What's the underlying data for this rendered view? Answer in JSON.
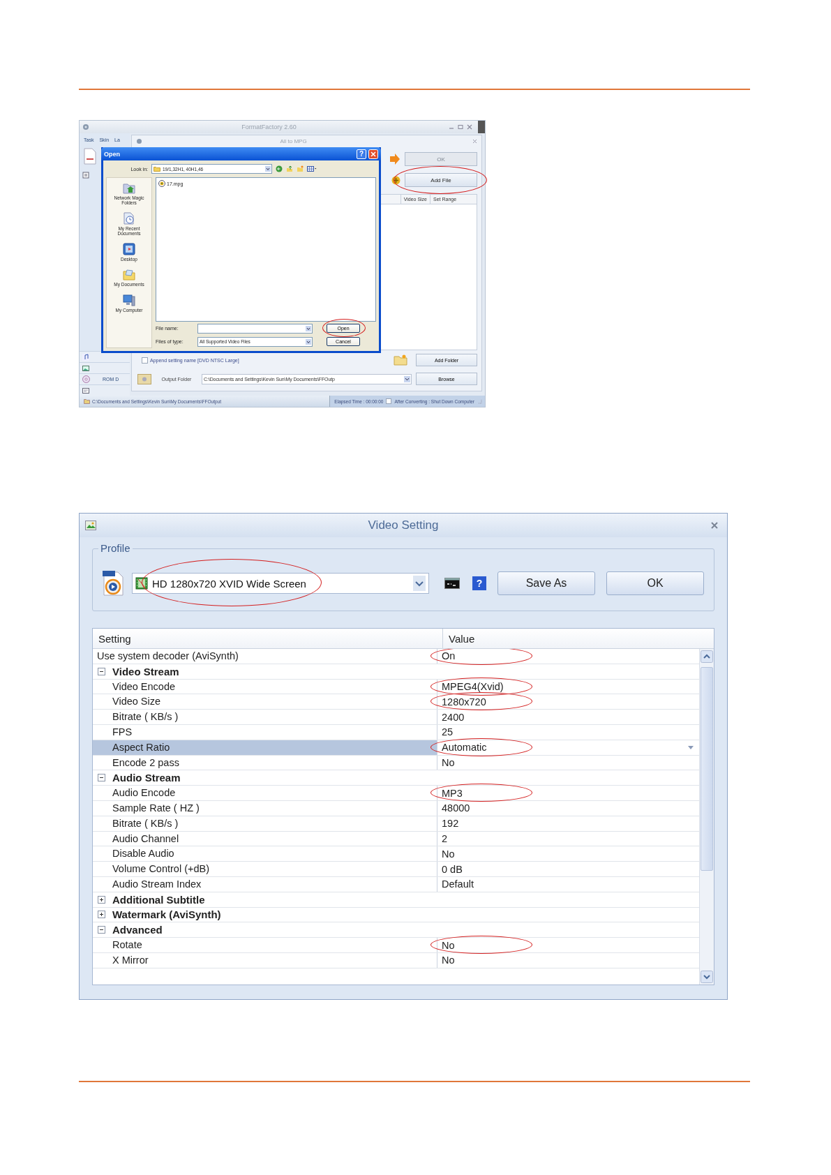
{
  "format_factory_window": {
    "title": "FormatFactory 2.60",
    "menu": [
      "Task",
      "Skin",
      "La"
    ],
    "sidebar_text": "ROM D",
    "panel_title": "All to MPG",
    "progress_button": {
      "label": "OK",
      "disabled": true
    },
    "add_file_button": {
      "label": "Add File",
      "circled": true
    },
    "columns": [
      "Video Size",
      "Set Range"
    ],
    "append_checkbox": {
      "label": "Append setting name [DVD NTSC Large]",
      "checked": false
    },
    "add_folder_button": "Add Folder",
    "output_folder": {
      "label": "Output Folder",
      "value": "C:\\Documents and Settings\\Kevin Sun\\My Documents\\FFOutp"
    },
    "browse_button": "Browse",
    "status_bar": {
      "path": "C:\\Documents and Settings\\Kevin Sun\\My Documents\\FFOutput",
      "elapsed": "Elapsed Time : 00:00:00",
      "shutdown": {
        "label": "After Converting : Shut Down Computer",
        "checked": false
      }
    },
    "open_dialog": {
      "title": "Open",
      "help_button": "?",
      "look_in_label": "Look in:",
      "look_in_value": "19/1,32H1, 40H1,46",
      "files": [
        "17.mpg"
      ],
      "places": [
        {
          "label": "Network Magic Folders",
          "kind": "network"
        },
        {
          "label": "My Recent Documents",
          "kind": "recent"
        },
        {
          "label": "Desktop",
          "kind": "desktop"
        },
        {
          "label": "My Documents",
          "kind": "documents"
        },
        {
          "label": "My Computer",
          "kind": "computer"
        }
      ],
      "file_name_label": "File name:",
      "file_type_label": "Files of type:",
      "file_type_value": "All Supported Video Files",
      "open_button": {
        "label": "Open",
        "circled": true
      },
      "cancel_button": "Cancel"
    }
  },
  "video_setting_window": {
    "title": "Video Setting",
    "profile_label": "Profile",
    "profile": {
      "value": "HD 1280x720 XVID Wide Screen",
      "circled": true
    },
    "help_button": "?",
    "save_as_button": "Save As",
    "ok_button": "OK",
    "columns": [
      "Setting",
      "Value"
    ],
    "rows": [
      {
        "kind": "setting",
        "label": "Use system decoder (AviSynth)",
        "value": "On",
        "selected": false,
        "circled": true
      },
      {
        "kind": "group",
        "label": "Video Stream",
        "expanded": true,
        "children": [
          {
            "kind": "setting",
            "label": "Video Encode",
            "value": "MPEG4(Xvid)",
            "selected": false,
            "circled": true
          },
          {
            "kind": "setting",
            "label": "Video Size",
            "value": "1280x720",
            "selected": false,
            "circled": true
          },
          {
            "kind": "setting",
            "label": "Bitrate ( KB/s )",
            "value": "2400",
            "selected": false,
            "circled": false
          },
          {
            "kind": "setting",
            "label": "FPS",
            "value": "25",
            "selected": false,
            "circled": false
          },
          {
            "kind": "setting",
            "label": "Aspect Ratio",
            "value": "Automatic",
            "selected": true,
            "circled": true
          },
          {
            "kind": "setting",
            "label": "Encode 2 pass",
            "value": "No",
            "selected": false,
            "circled": false
          }
        ]
      },
      {
        "kind": "group",
        "label": "Audio Stream",
        "expanded": true,
        "children": [
          {
            "kind": "setting",
            "label": "Audio Encode",
            "value": "MP3",
            "selected": false,
            "circled": true
          },
          {
            "kind": "setting",
            "label": "Sample Rate ( HZ )",
            "value": "48000",
            "selected": false,
            "circled": false
          },
          {
            "kind": "setting",
            "label": "Bitrate ( KB/s )",
            "value": "192",
            "selected": false,
            "circled": false
          },
          {
            "kind": "setting",
            "label": "Audio Channel",
            "value": "2",
            "selected": false,
            "circled": false
          },
          {
            "kind": "setting",
            "label": "Disable Audio",
            "value": "No",
            "selected": false,
            "circled": false
          },
          {
            "kind": "setting",
            "label": "Volume Control (+dB)",
            "value": "0 dB",
            "selected": false,
            "circled": false
          },
          {
            "kind": "setting",
            "label": "Audio Stream Index",
            "value": "Default",
            "selected": false,
            "circled": false
          }
        ]
      },
      {
        "kind": "group",
        "label": "Additional Subtitle",
        "expanded": false
      },
      {
        "kind": "group",
        "label": "Watermark (AviSynth)",
        "expanded": false
      },
      {
        "kind": "group",
        "label": "Advanced",
        "expanded": true,
        "children": [
          {
            "kind": "setting",
            "label": "Rotate",
            "value": "No",
            "selected": false,
            "circled": true
          },
          {
            "kind": "setting",
            "label": "X Mirror",
            "value": "No",
            "selected": false,
            "circled": false
          }
        ]
      }
    ]
  }
}
